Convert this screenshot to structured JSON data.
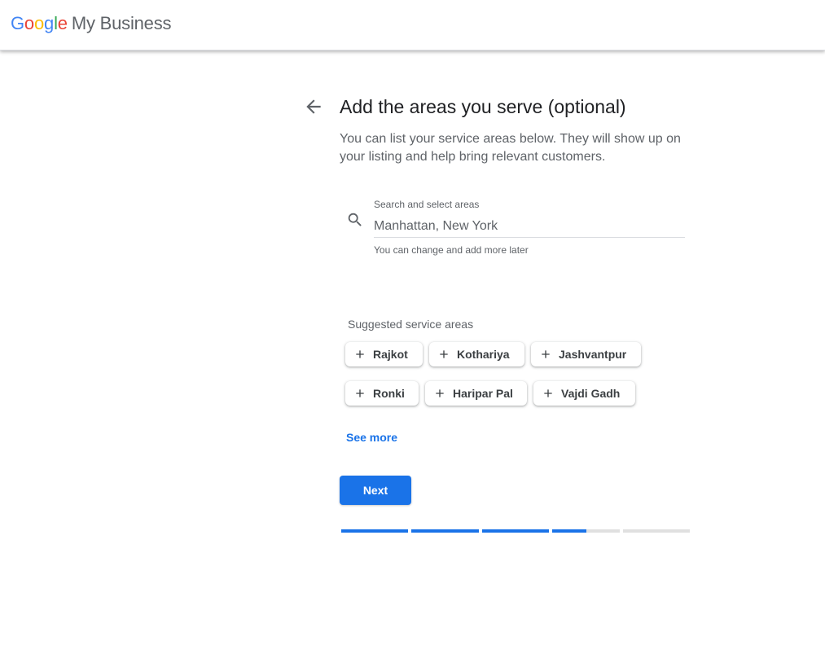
{
  "header": {
    "logo": {
      "letters": [
        "G",
        "o",
        "o",
        "g",
        "l",
        "e"
      ],
      "product": "My Business"
    }
  },
  "page": {
    "title": "Add the areas you serve (optional)",
    "subtitle": "You can list your service areas below. They will show up on your listing and help bring relevant customers."
  },
  "search": {
    "label": "Search and select areas",
    "placeholder": "Manhattan, New York",
    "value": "",
    "helper": "You can change and add more later",
    "icon": "search-icon"
  },
  "suggestions": {
    "label": "Suggested service areas",
    "chips": [
      "Rajkot",
      "Kothariya",
      "Jashvantpur",
      "Ronki",
      "Haripar Pal",
      "Vajdi Gadh"
    ]
  },
  "see_more_label": "See more",
  "next_label": "Next",
  "progress": {
    "segments": [
      1,
      1,
      1,
      0.5,
      0
    ]
  },
  "colors": {
    "accent": "#1a73e8",
    "track": "#e0e0e0"
  }
}
